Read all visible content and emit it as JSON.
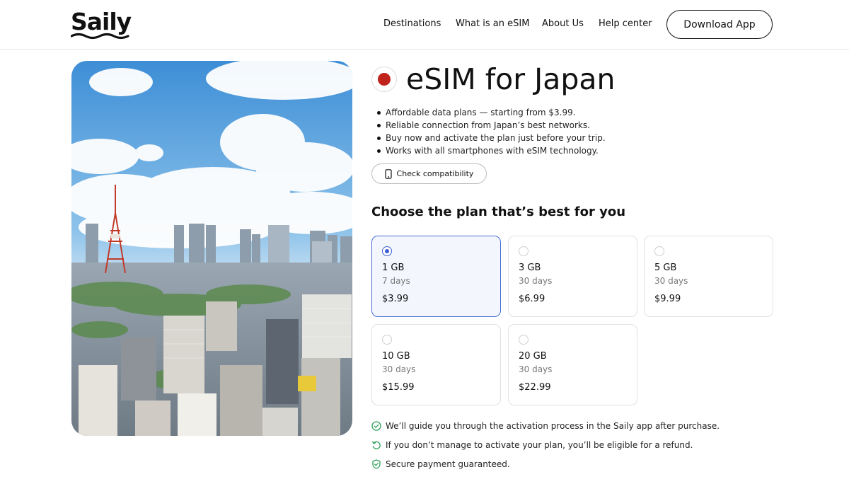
{
  "header": {
    "logo_text": "Saily",
    "nav": [
      "Destinations",
      "What is an eSIM",
      "About Us",
      "Help center"
    ],
    "download_label": "Download App"
  },
  "hero": {
    "image": "tokyo-skyline-photo"
  },
  "product": {
    "title": "eSIM for Japan",
    "flag_color": "#c0241c",
    "bullets": [
      "Affordable data plans — starting from $3.99.",
      "Reliable connection from Japan’s best networks.",
      "Buy now and activate the plan just before your trip.",
      "Works with all smartphones with eSIM technology."
    ],
    "compat_label": "Check compatibility"
  },
  "plans": {
    "heading": "Choose the plan that’s best for you",
    "accent": "#3d5fd6",
    "options": [
      {
        "data": "1 GB",
        "days": "7 days",
        "price": "$3.99",
        "selected": true
      },
      {
        "data": "3 GB",
        "days": "30 days",
        "price": "$6.99",
        "selected": false
      },
      {
        "data": "5 GB",
        "days": "30 days",
        "price": "$9.99",
        "selected": false
      },
      {
        "data": "10 GB",
        "days": "30 days",
        "price": "$15.99",
        "selected": false
      },
      {
        "data": "20 GB",
        "days": "30 days",
        "price": "$22.99",
        "selected": false
      }
    ]
  },
  "assurances": {
    "icon_color": "#2fa05a",
    "items": [
      {
        "icon": "check-circle-icon",
        "text": "We’ll guide you through the activation process in the Saily app after purchase."
      },
      {
        "icon": "refund-icon",
        "text": "If you don’t manage to activate your plan, you’ll be eligible for a refund."
      },
      {
        "icon": "shield-check-icon",
        "text": "Secure payment guaranteed."
      }
    ]
  }
}
